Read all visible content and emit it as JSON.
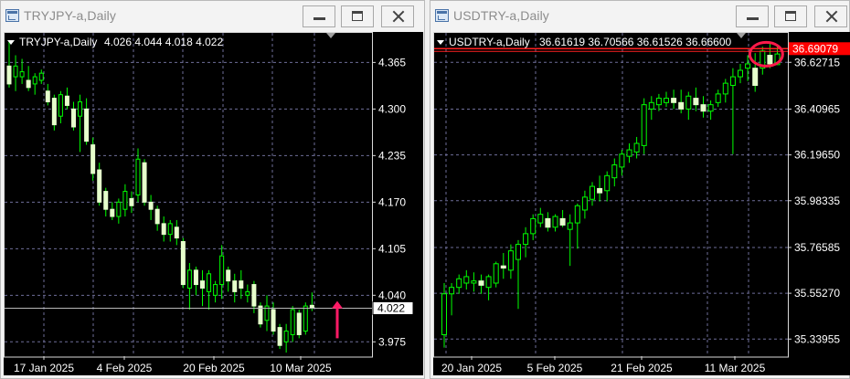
{
  "windows": [
    {
      "title": "TRYJPY-a,Daily",
      "buttons": {
        "minimize": "minimize",
        "maximize": "maximize",
        "close": "close"
      },
      "chart_data": {
        "type": "candlestick",
        "info": {
          "symbol": "TRYJPY-a,Daily",
          "open": "4.026",
          "high": "4.044",
          "low": "4.018",
          "close": "4.022"
        },
        "ylim": [
          3.955,
          4.405
        ],
        "y_ticks": [
          "4.365",
          "4.300",
          "4.235",
          "4.170",
          "4.105",
          "4.040",
          "3.975"
        ],
        "x_labels": [
          "17 Jan 2025",
          "4 Feb 2025",
          "20 Feb 2025",
          "10 Mar 2025"
        ],
        "current_price": "4.022",
        "candles": [
          [
            4.36,
            4.395,
            4.33,
            4.335
          ],
          [
            4.345,
            4.375,
            4.325,
            4.36
          ],
          [
            4.345,
            4.37,
            4.335,
            4.352
          ],
          [
            4.34,
            4.36,
            4.325,
            4.33
          ],
          [
            4.335,
            4.35,
            4.32,
            4.345
          ],
          [
            4.34,
            4.355,
            4.335,
            4.35
          ],
          [
            4.325,
            4.335,
            4.305,
            4.31
          ],
          [
            4.315,
            4.32,
            4.27,
            4.278
          ],
          [
            4.29,
            4.325,
            4.28,
            4.32
          ],
          [
            4.318,
            4.33,
            4.3,
            4.305
          ],
          [
            4.3,
            4.31,
            4.27,
            4.275
          ],
          [
            4.29,
            4.32,
            4.24,
            4.31
          ],
          [
            4.3,
            4.315,
            4.25,
            4.255
          ],
          [
            4.25,
            4.26,
            4.2,
            4.21
          ],
          [
            4.215,
            4.225,
            4.165,
            4.17
          ],
          [
            4.185,
            4.19,
            4.15,
            4.16
          ],
          [
            4.16,
            4.17,
            4.145,
            4.15
          ],
          [
            4.15,
            4.175,
            4.14,
            4.17
          ],
          [
            4.16,
            4.195,
            4.15,
            4.185
          ],
          [
            4.175,
            4.185,
            4.155,
            4.165
          ],
          [
            4.18,
            4.245,
            4.17,
            4.23
          ],
          [
            4.225,
            4.23,
            4.165,
            4.17
          ],
          [
            4.17,
            4.18,
            4.145,
            4.16
          ],
          [
            4.16,
            4.165,
            4.13,
            4.14
          ],
          [
            4.14,
            4.15,
            4.115,
            4.125
          ],
          [
            4.125,
            4.145,
            4.115,
            4.14
          ],
          [
            4.135,
            4.145,
            4.11,
            4.12
          ],
          [
            4.115,
            4.12,
            4.05,
            4.055
          ],
          [
            4.05,
            4.085,
            4.02,
            4.075
          ],
          [
            4.075,
            4.08,
            4.04,
            4.055
          ],
          [
            4.06,
            4.075,
            4.025,
            4.05
          ],
          [
            4.045,
            4.075,
            4.02,
            4.07
          ],
          [
            4.04,
            4.06,
            4.03,
            4.055
          ],
          [
            4.055,
            4.11,
            4.035,
            4.095
          ],
          [
            4.075,
            4.08,
            4.045,
            4.06
          ],
          [
            4.06,
            4.07,
            4.03,
            4.045
          ],
          [
            4.06,
            4.075,
            4.035,
            4.05
          ],
          [
            4.04,
            4.055,
            4.03,
            4.045
          ],
          [
            4.055,
            4.06,
            4.015,
            4.025
          ],
          [
            4.025,
            4.03,
            3.995,
            4.0
          ],
          [
            4.005,
            4.04,
            3.99,
            4.025
          ],
          [
            4.02,
            4.03,
            3.985,
            3.99
          ],
          [
            3.995,
            4.0,
            3.965,
            3.97
          ],
          [
            3.975,
            4.0,
            3.96,
            3.99
          ],
          [
            3.985,
            4.025,
            3.975,
            4.02
          ],
          [
            4.015,
            4.02,
            3.98,
            3.985
          ],
          [
            3.99,
            4.03,
            3.985,
            4.025
          ],
          [
            4.026,
            4.044,
            4.018,
            4.022
          ]
        ]
      }
    },
    {
      "title": "USDTRY-a,Daily",
      "buttons": {
        "minimize": "minimize",
        "maximize": "maximize",
        "close": "close"
      },
      "chart_data": {
        "type": "candlestick",
        "info": {
          "symbol": "USDTRY-a,Daily",
          "open": "36.61619",
          "high": "36.70566",
          "low": "36.61526",
          "close": "36.66600"
        },
        "ylim": [
          35.26,
          36.76
        ],
        "y_ticks": [
          "36.62715",
          "36.40965",
          "36.19650",
          "35.98335",
          "35.76585",
          "35.55270",
          "35.33955"
        ],
        "x_labels": [
          "20 Jan 2025",
          "5 Feb 2025",
          "21 Feb 2025",
          "11 Mar 2025"
        ],
        "current_price": "36.69079",
        "annotation": "circle around latest candles",
        "candles": [
          [
            35.36,
            35.6,
            35.3,
            35.55
          ],
          [
            35.55,
            35.6,
            35.45,
            35.58
          ],
          [
            35.58,
            35.64,
            35.55,
            35.62
          ],
          [
            35.6,
            35.66,
            35.57,
            35.63
          ],
          [
            35.6,
            35.65,
            35.56,
            35.61
          ],
          [
            35.61,
            35.64,
            35.55,
            35.59
          ],
          [
            35.58,
            35.64,
            35.52,
            35.63
          ],
          [
            35.6,
            35.7,
            35.58,
            35.69
          ],
          [
            35.68,
            35.74,
            35.62,
            35.67
          ],
          [
            35.66,
            35.78,
            35.62,
            35.75
          ],
          [
            35.71,
            35.8,
            35.48,
            35.78
          ],
          [
            35.78,
            35.86,
            35.72,
            35.83
          ],
          [
            35.83,
            35.92,
            35.8,
            35.9
          ],
          [
            35.88,
            35.95,
            35.86,
            35.92
          ],
          [
            35.9,
            35.93,
            35.84,
            35.86
          ],
          [
            35.86,
            35.92,
            35.84,
            35.91
          ],
          [
            35.9,
            35.94,
            35.86,
            35.87
          ],
          [
            35.85,
            35.92,
            35.68,
            35.88
          ],
          [
            35.88,
            35.97,
            35.76,
            35.96
          ],
          [
            35.94,
            36.03,
            35.9,
            36.0
          ],
          [
            35.99,
            36.07,
            35.96,
            36.05
          ],
          [
            36.04,
            36.1,
            35.98,
            36.02
          ],
          [
            36.03,
            36.12,
            35.98,
            36.1
          ],
          [
            36.09,
            36.18,
            36.05,
            36.15
          ],
          [
            36.14,
            36.22,
            36.1,
            36.2
          ],
          [
            36.19,
            36.25,
            36.16,
            36.22
          ],
          [
            36.21,
            36.28,
            36.18,
            36.25
          ],
          [
            36.24,
            36.46,
            36.2,
            36.43
          ],
          [
            36.41,
            36.47,
            36.36,
            36.44
          ],
          [
            36.43,
            36.48,
            36.4,
            36.46
          ],
          [
            36.44,
            36.49,
            36.42,
            36.46
          ],
          [
            36.46,
            36.5,
            36.41,
            36.44
          ],
          [
            36.44,
            36.5,
            36.39,
            36.41
          ],
          [
            36.41,
            36.49,
            36.36,
            36.47
          ],
          [
            36.46,
            36.51,
            36.4,
            36.43
          ],
          [
            36.43,
            36.47,
            36.37,
            36.4
          ],
          [
            36.4,
            36.45,
            36.36,
            36.43
          ],
          [
            36.44,
            36.5,
            36.42,
            36.48
          ],
          [
            36.48,
            36.55,
            36.44,
            36.53
          ],
          [
            36.52,
            36.6,
            36.2,
            36.56
          ],
          [
            36.56,
            36.62,
            36.53,
            36.59
          ],
          [
            36.6,
            36.66,
            36.54,
            36.62
          ],
          [
            36.6,
            36.67,
            36.49,
            36.52
          ],
          [
            36.6,
            36.7,
            36.57,
            36.68
          ],
          [
            36.66,
            36.72,
            36.6,
            36.62
          ],
          [
            36.61619,
            36.70566,
            36.61526,
            36.666
          ]
        ]
      }
    }
  ]
}
